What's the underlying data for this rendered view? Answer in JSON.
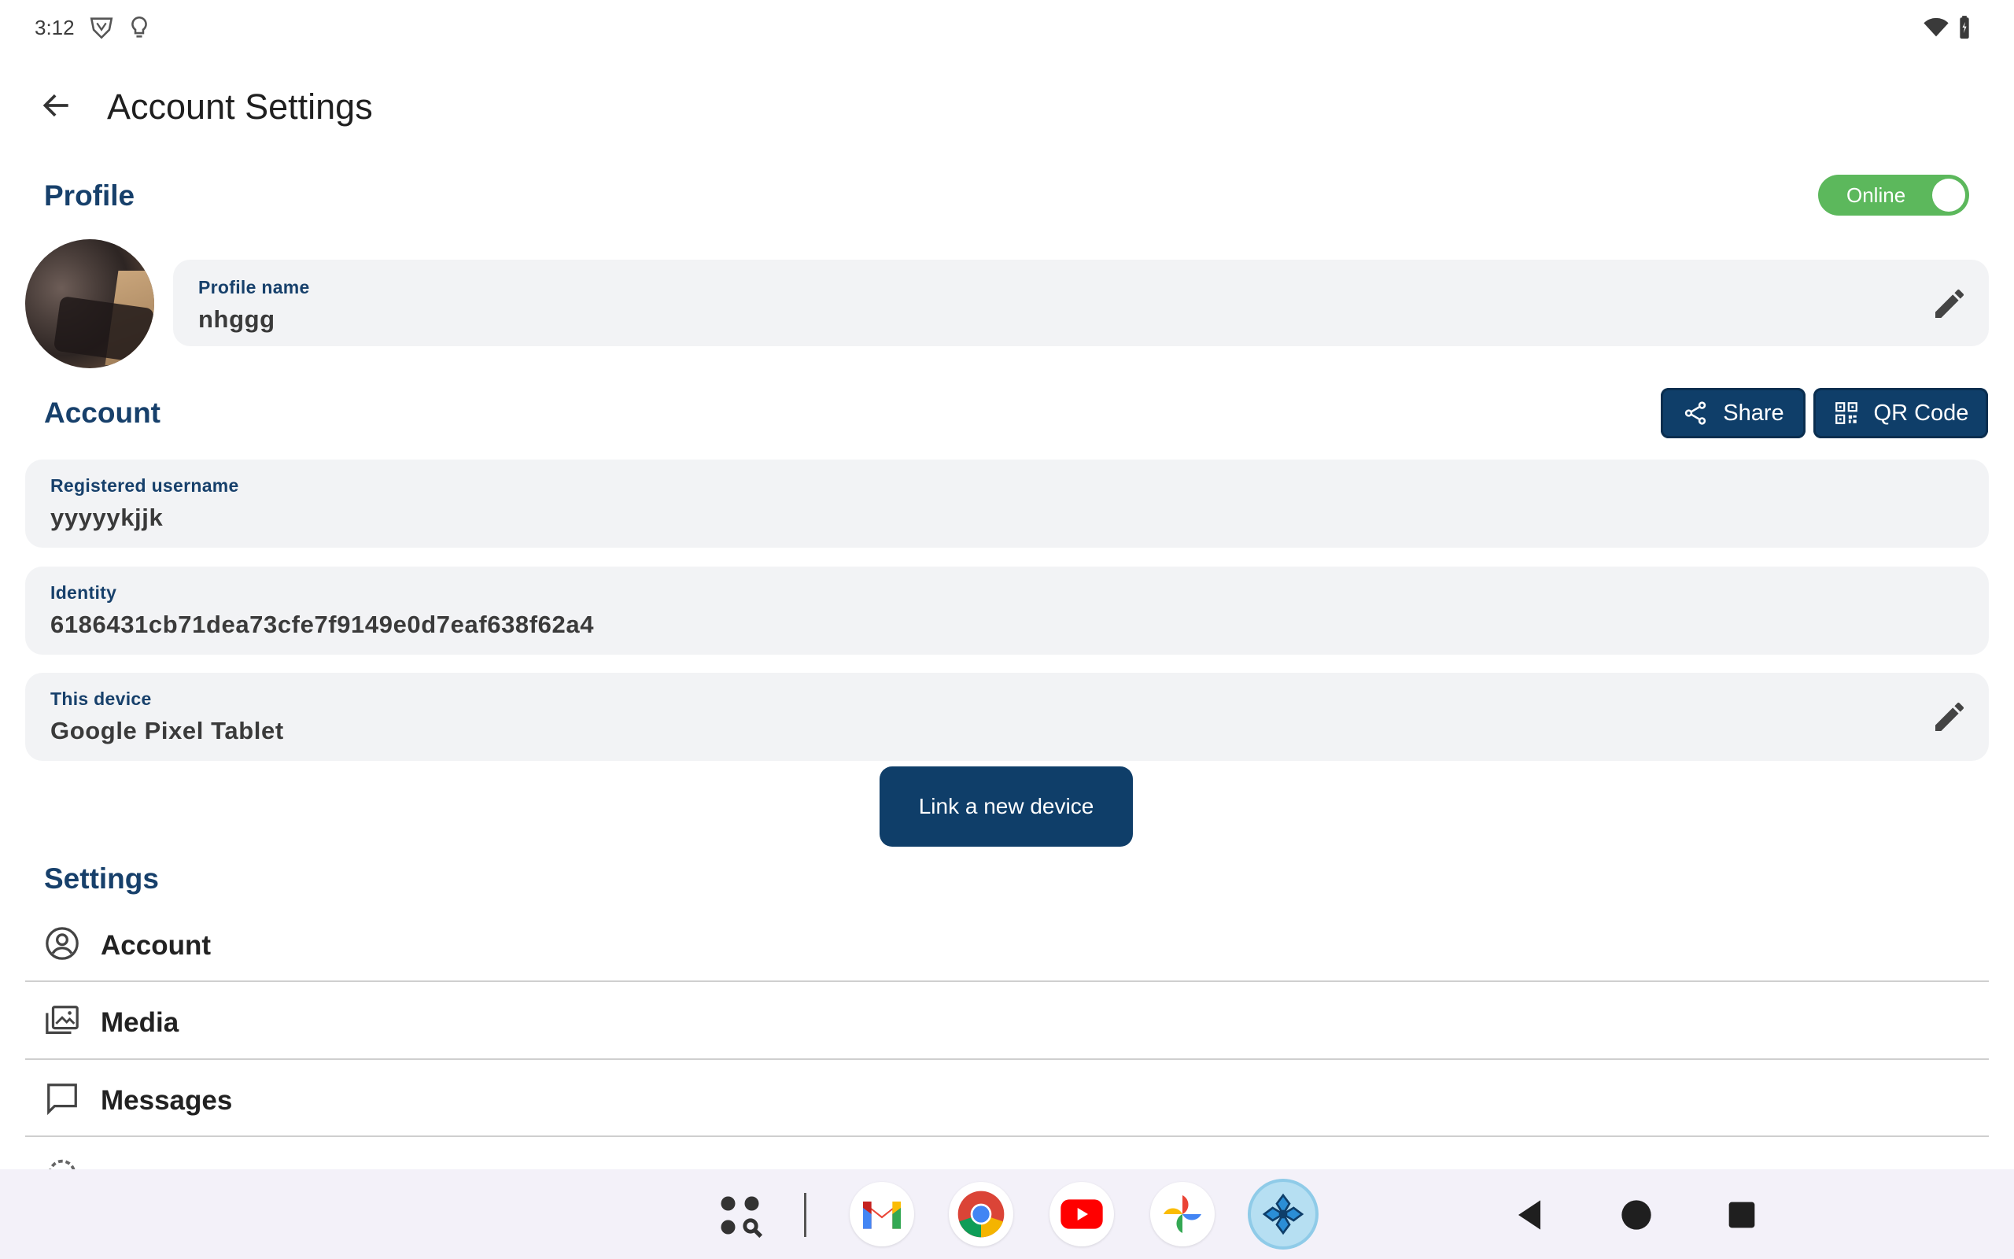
{
  "status_bar": {
    "time": "3:12",
    "icons": [
      "vpn-shield-icon",
      "lightbulb-icon",
      "wifi-icon",
      "battery-icon"
    ]
  },
  "header": {
    "title": "Account Settings",
    "back_icon": "arrow-left-icon"
  },
  "profile": {
    "section_title": "Profile",
    "status_toggle": {
      "label": "Online",
      "on": true,
      "color": "#5cb85c"
    },
    "name_label": "Profile name",
    "name_value": "nhggg"
  },
  "account": {
    "section_title": "Account",
    "share_label": "Share",
    "qr_label": "QR Code",
    "username_label": "Registered username",
    "username_value": "yyyyykjjk",
    "identity_label": "Identity",
    "identity_value": "6186431cb71dea73cfe7f9149e0d7eaf638f62a4",
    "device_label": "This device",
    "device_value": "Google Pixel Tablet",
    "link_button": "Link a new device"
  },
  "settings": {
    "section_title": "Settings",
    "items": [
      {
        "label": "Account",
        "icon": "account-circle-icon"
      },
      {
        "label": "Media",
        "icon": "media-library-icon"
      },
      {
        "label": "Messages",
        "icon": "chat-bubble-icon"
      }
    ]
  },
  "taskbar": {
    "apps": [
      "app-drawer-icon",
      "gmail-icon",
      "chrome-icon",
      "youtube-icon",
      "photos-icon",
      "jami-icon"
    ],
    "nav": [
      "back-nav-icon",
      "home-nav-icon",
      "recents-nav-icon"
    ]
  },
  "colors": {
    "accent": "#17406b",
    "button": "#0f3e69",
    "card": "#f2f3f5"
  }
}
